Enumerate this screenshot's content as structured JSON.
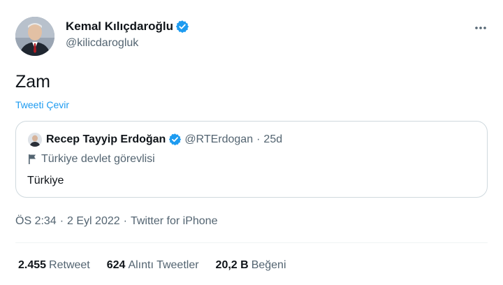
{
  "author": {
    "name": "Kemal Kılıçdaroğlu",
    "handle": "@kilicdarogluk"
  },
  "tweet": {
    "text": "Zam",
    "translate_label": "Tweeti Çevir"
  },
  "quoted": {
    "name": "Recep Tayyip Erdoğan",
    "handle": "@RTErdogan",
    "separator": "·",
    "time": "25d",
    "label": "Türkiye devlet görevlisi",
    "text": "Türkiye"
  },
  "meta": {
    "time": "ÖS 2:34",
    "separator1": "·",
    "date": "2 Eyl 2022",
    "separator2": "·",
    "source": "Twitter for iPhone"
  },
  "stats": {
    "retweets": {
      "count": "2.455",
      "label": "Retweet"
    },
    "quotes": {
      "count": "624",
      "label": "Alıntı Tweetler"
    },
    "likes": {
      "count": "20,2 B",
      "label": "Beğeni"
    }
  },
  "colors": {
    "accent": "#1d9bf0",
    "text": "#0f1419",
    "secondary": "#536471",
    "border": "#cfd9de"
  },
  "icons": {
    "verified": "verified-badge-icon",
    "more": "more-options-icon",
    "label": "flag-icon"
  }
}
